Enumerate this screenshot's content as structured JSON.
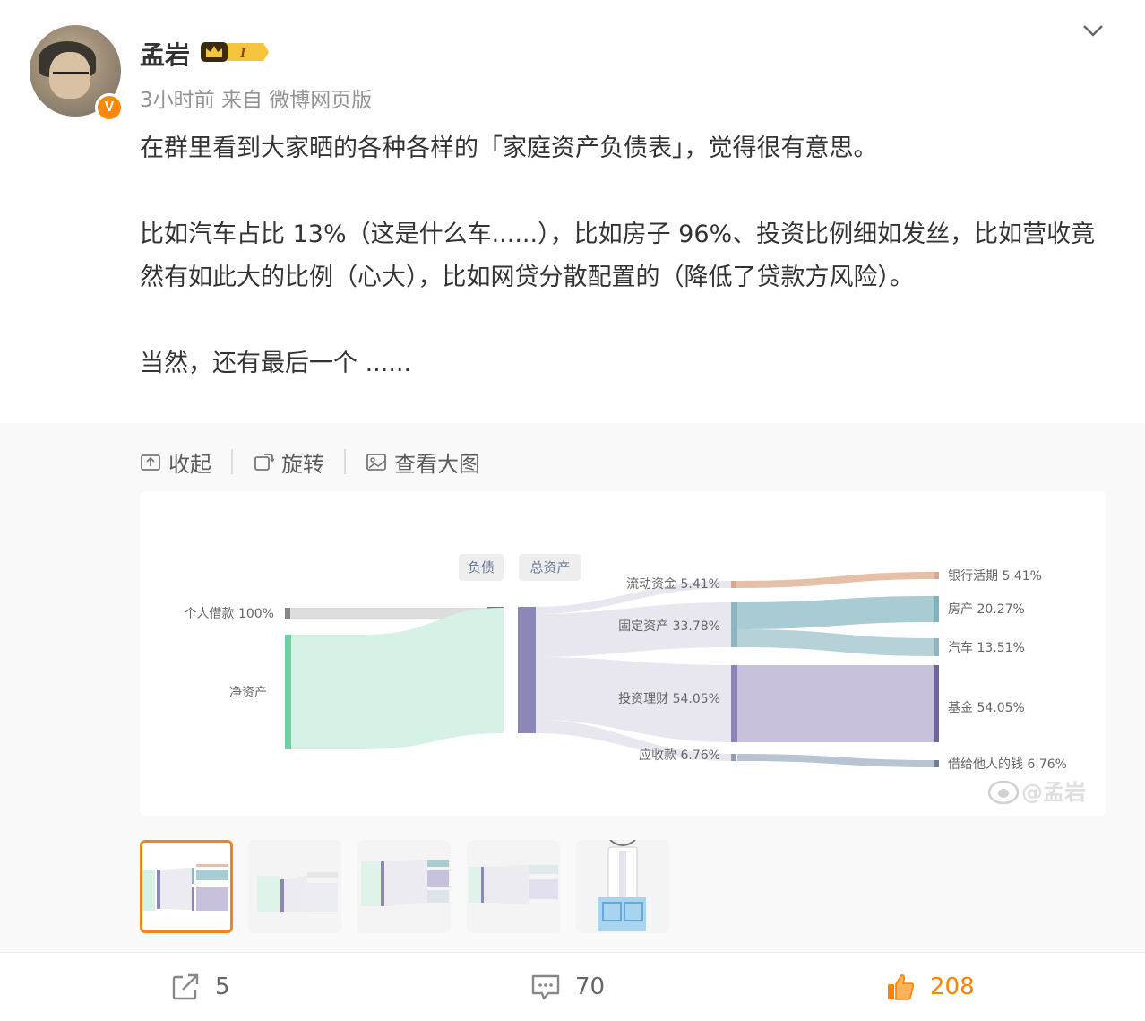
{
  "user": {
    "name": "孟岩",
    "level": "I",
    "verified": "V"
  },
  "meta": "3小时前  来自 微博网页版",
  "post": {
    "p1": "在群里看到大家晒的各种各样的「家庭资产负债表」，觉得很有意思。",
    "p2": "比如汽车占比 13%（这是什么车......），比如房子 96%、投资比例细如发丝，比如营收竟然有如此大的比例（心大），比如网贷分散配置的（降低了贷款方风险）。",
    "p3": "当然，还有最后一个 ......"
  },
  "toolbar": {
    "collapse": "收起",
    "rotate": "旋转",
    "view_large": "查看大图"
  },
  "chart_data": {
    "type": "sankey",
    "headers": [
      "负债",
      "总资产"
    ],
    "left_nodes": [
      {
        "label": "个人借款 100%"
      },
      {
        "label": "净资产"
      }
    ],
    "mid_nodes": [
      {
        "label": "流动资金 5.41%",
        "value": 5.41
      },
      {
        "label": "固定资产 33.78%",
        "value": 33.78
      },
      {
        "label": "投资理财 54.05%",
        "value": 54.05
      },
      {
        "label": "应收款 6.76%",
        "value": 6.76
      }
    ],
    "right_nodes": [
      {
        "label": "银行活期 5.41%",
        "value": 5.41
      },
      {
        "label": "房产 20.27%",
        "value": 20.27
      },
      {
        "label": "汽车 13.51%",
        "value": 13.51
      },
      {
        "label": "基金 54.05%",
        "value": 54.05
      },
      {
        "label": "借给他人的钱 6.76%",
        "value": 6.76
      }
    ],
    "watermark": "@孟岩",
    "colors": {
      "liquid": "#d9a88a",
      "fixed": "#9ec3cc",
      "invest": "#a99ecb",
      "receivable": "#a8b4c8",
      "total": "#8b88b8",
      "net": "#8fdcbb",
      "debt": "#c8c8c8"
    }
  },
  "actions": {
    "share": "5",
    "comment": "70",
    "like": "208"
  },
  "accent": "#ff8200"
}
